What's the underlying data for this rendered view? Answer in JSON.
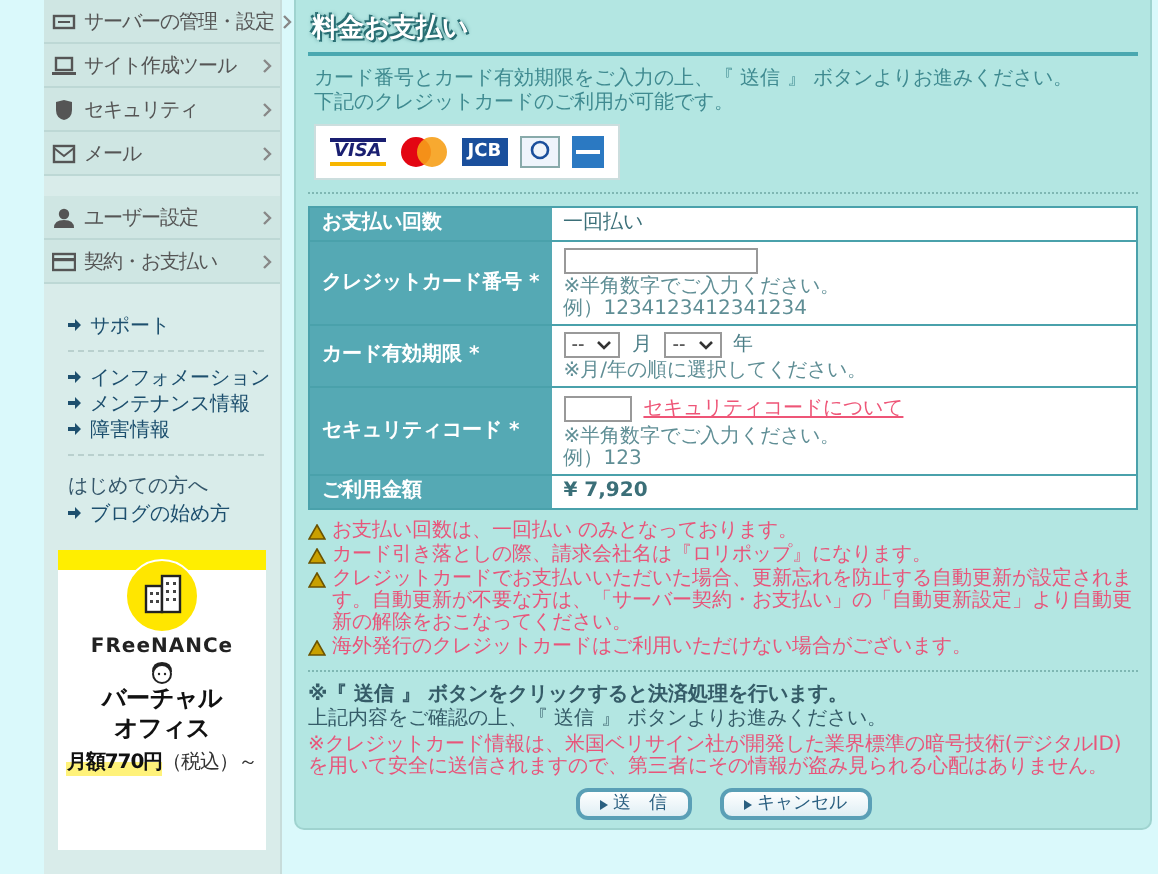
{
  "sidebar": {
    "menu_groups": [
      [
        {
          "label": "サーバーの管理・設定"
        },
        {
          "label": "サイト作成ツール"
        },
        {
          "label": "セキュリティ"
        },
        {
          "label": "メール"
        }
      ],
      [
        {
          "label": "ユーザー設定"
        },
        {
          "label": "契約・お支払い"
        }
      ]
    ],
    "link_sections": [
      {
        "items": [
          "サポート"
        ]
      },
      {
        "items": [
          "インフォメーション",
          "メンテナンス情報",
          "障害情報"
        ]
      },
      {
        "heading": "はじめての方へ",
        "items": [
          "ブログの始め方"
        ]
      }
    ],
    "banner": {
      "brand": "FReeNANCe",
      "headline": [
        "バーチャル",
        "オフィス"
      ],
      "price": "月額770円",
      "price_note": "（税込）～"
    }
  },
  "main": {
    "title": "料金お支払い",
    "intro": [
      "カード番号とカード有効期限をご入力の上、『 送信 』 ボタンよりお進みください。",
      "下記のクレジットカードのご利用が可能です。"
    ],
    "card_logos": [
      {
        "kind": "visa",
        "text": "VISA"
      },
      {
        "kind": "mastercard"
      },
      {
        "kind": "jcb",
        "text": "JCB"
      },
      {
        "kind": "diners"
      },
      {
        "kind": "amex"
      }
    ],
    "form_rows": [
      {
        "kind": "static",
        "label": "お支払い回数",
        "value": "一回払い"
      },
      {
        "kind": "card_number",
        "label": "クレジットカード番号 *",
        "hints": [
          "※半角数字でご入力ください。",
          "例）1234123412341234"
        ]
      },
      {
        "kind": "expiry",
        "label": "カード有効期限 *",
        "selects": [
          {
            "value": "--",
            "unit": "月"
          },
          {
            "value": "--",
            "unit": "年"
          }
        ],
        "hints": [
          "※月/年の順に選択してください。"
        ]
      },
      {
        "kind": "security",
        "label": "セキュリティコード *",
        "link": "セキュリティコードについて",
        "hints": [
          "※半角数字でご入力ください。",
          "例）123"
        ]
      },
      {
        "kind": "amount",
        "label": "ご利用金額",
        "value": "¥ 7,920"
      }
    ],
    "warnings": [
      "お支払い回数は、一回払い のみとなっております。",
      "カード引き落としの際、請求会社名は『ロリポップ』になります。",
      "クレジットカードでお支払いいただいた場合、更新忘れを防止する自動更新が設定されます。自動更新が不要な方は、「サーバー契約・お支払い」の「自動更新設定」より自動更新の解除をおこなってください。",
      "海外発行のクレジットカードはご利用いただけない場合がございます。"
    ],
    "confirm_bold": "※『 送信 』 ボタンをクリックすると決済処理を行います。",
    "confirm": "上記内容をご確認の上、『 送信 』 ボタンよりお進みください。",
    "security_note": "※クレジットカード情報は、米国ベリサイン社が開発した業界標準の暗号技術(デジタルID)を用いて安全に送信されますので、第三者にその情報が盗み見られる心配はありません。",
    "buttons": [
      "送　信",
      "キャンセル"
    ]
  }
}
